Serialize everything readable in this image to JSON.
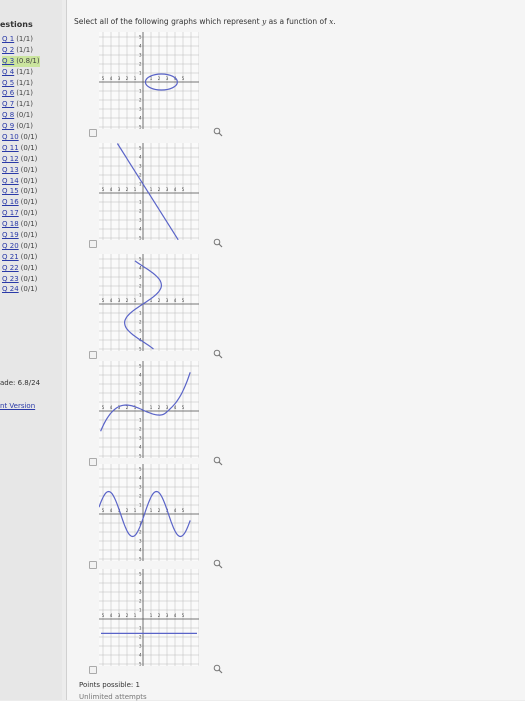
{
  "sidebar": {
    "title": "estions",
    "questions": [
      {
        "label": "Q 1",
        "score": "(1/1)"
      },
      {
        "label": "Q 2",
        "score": "(1/1)"
      },
      {
        "label": "Q 3",
        "score": "(0.8/1)",
        "active": true
      },
      {
        "label": "Q 4",
        "score": "(1/1)"
      },
      {
        "label": "Q 5",
        "score": "(1/1)"
      },
      {
        "label": "Q 6",
        "score": "(1/1)"
      },
      {
        "label": "Q 7",
        "score": "(1/1)"
      },
      {
        "label": "Q 8",
        "score": "(0/1)"
      },
      {
        "label": "Q 9",
        "score": "(0/1)"
      },
      {
        "label": "Q 10",
        "score": "(0/1)"
      },
      {
        "label": "Q 11",
        "score": "(0/1)"
      },
      {
        "label": "Q 12",
        "score": "(0/1)"
      },
      {
        "label": "Q 13",
        "score": "(0/1)"
      },
      {
        "label": "Q 14",
        "score": "(0/1)"
      },
      {
        "label": "Q 15",
        "score": "(0/1)"
      },
      {
        "label": "Q 16",
        "score": "(0/1)"
      },
      {
        "label": "Q 17",
        "score": "(0/1)"
      },
      {
        "label": "Q 18",
        "score": "(0/1)"
      },
      {
        "label": "Q 19",
        "score": "(0/1)"
      },
      {
        "label": "Q 20",
        "score": "(0/1)"
      },
      {
        "label": "Q 21",
        "score": "(0/1)"
      },
      {
        "label": "Q 22",
        "score": "(0/1)"
      },
      {
        "label": "Q 23",
        "score": "(0/1)"
      },
      {
        "label": "Q 24",
        "score": "(0/1)"
      }
    ],
    "grade": "ade: 6.8/24",
    "print_link": "nt Version"
  },
  "question": {
    "prompt_before": "Select all of the following graphs which represent ",
    "var_y": "y",
    "prompt_middle": " as a function of ",
    "var_x": "x",
    "prompt_after": "."
  },
  "graphs": [
    {
      "curve": "ellipse"
    },
    {
      "curve": "line"
    },
    {
      "curve": "sideways-s"
    },
    {
      "curve": "cubic"
    },
    {
      "curve": "sine"
    },
    {
      "curve": "horizontal-line"
    }
  ],
  "tick_labels": {
    "x_left": [
      "5",
      "4",
      "3",
      "2",
      "1"
    ],
    "x_right": [
      "1",
      "2",
      "3",
      "4",
      "5"
    ],
    "y_up": [
      "5",
      "4",
      "3",
      "2",
      "1"
    ],
    "y_down": [
      "1",
      "2",
      "3",
      "4",
      "5"
    ]
  },
  "zoom_icon": "magnifier-icon",
  "colors": {
    "curve": "#5a64c8",
    "grid": "#bbbbbb",
    "axis": "#555555",
    "highlight": "#cbe59e",
    "link": "#2a3aa8"
  },
  "footer": {
    "points_label": "Points possible: 1",
    "attempts_label": "Unlimited attempts"
  }
}
